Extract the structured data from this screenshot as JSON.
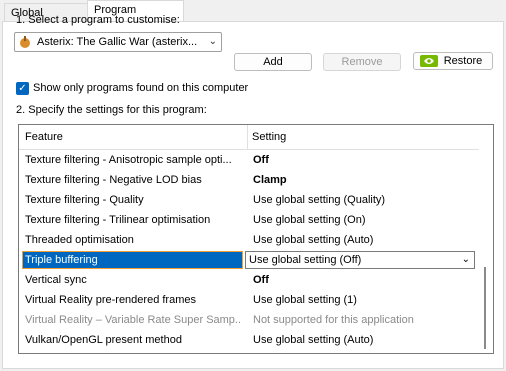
{
  "tabs": [
    "Global Settings",
    "Program Settings"
  ],
  "step1_label": "1. Select a program to customise:",
  "program": {
    "selected": "Asterix: The Gallic War (asterix..."
  },
  "buttons": {
    "add": "Add",
    "remove": "Remove",
    "restore": "Restore"
  },
  "show_only_label": "Show only programs found on this computer",
  "step2_label": "2. Specify the settings for this program:",
  "table": {
    "headers": [
      "Feature",
      "Setting"
    ],
    "rows": [
      {
        "feature": "Texture filtering - Anisotropic sample opti...",
        "setting": "Off"
      },
      {
        "feature": "Texture filtering - Negative LOD bias",
        "setting": "Clamp"
      },
      {
        "feature": "Texture filtering - Quality",
        "setting": "Use global setting (Quality)"
      },
      {
        "feature": "Texture filtering - Trilinear optimisation",
        "setting": "Use global setting (On)"
      },
      {
        "feature": "Threaded optimisation",
        "setting": "Use global setting (Auto)"
      },
      {
        "feature": "Triple buffering",
        "setting": "Use global setting (Off)"
      },
      {
        "feature": "Vertical sync",
        "setting": "Off"
      },
      {
        "feature": "Virtual Reality pre-rendered frames",
        "setting": "Use global setting (1)"
      },
      {
        "feature": "Virtual Reality – Variable Rate Super Samp...",
        "setting": "Not supported for this application"
      },
      {
        "feature": "Vulkan/OpenGL present method",
        "setting": "Use global setting (Auto)"
      }
    ]
  },
  "colors": {
    "accent": "#0067c0",
    "focus": "#f0a030"
  }
}
